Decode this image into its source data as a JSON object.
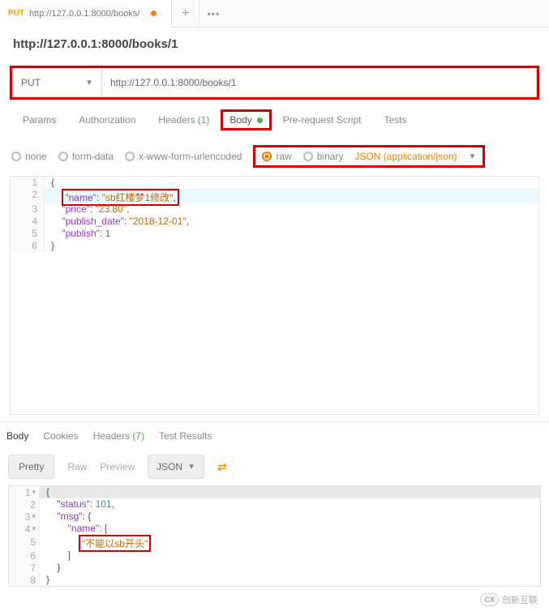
{
  "topTab": {
    "method": "PUT",
    "url": "http://127.0.0.1:8000/books/"
  },
  "title": "http://127.0.0.1:8000/books/1",
  "req": {
    "method": "PUT",
    "url": "http://127.0.0.1:8000/books/1"
  },
  "tabs": {
    "params": "Params",
    "auth": "Authorization",
    "headers": "Headers",
    "hcount": "(1)",
    "body": "Body",
    "prereq": "Pre-request Script",
    "tests": "Tests"
  },
  "bodyTypes": {
    "none": "none",
    "formdata": "form-data",
    "xform": "x-www-form-urlencoded",
    "raw": "raw",
    "binary": "binary",
    "ct": "JSON (application/json)"
  },
  "reqBody": {
    "l1": "{",
    "k2": "\"name\"",
    "v2": "\"sb红楼梦1修改\"",
    "k3": "\"price\"",
    "v3": "\"23.80\"",
    "k4": "\"publish_date\"",
    "v4": "\"2018-12-01\"",
    "k5": "\"publish\"",
    "v5": "1",
    "l6": "}"
  },
  "respTabs": {
    "body": "Body",
    "cookies": "Cookies",
    "headers": "Headers",
    "hcount": "(7)",
    "results": "Test Results"
  },
  "viewRow": {
    "pretty": "Pretty",
    "raw": "Raw",
    "preview": "Preview",
    "json": "JSON"
  },
  "respBody": {
    "l1": "{",
    "k2": "\"status\"",
    "v2": "101",
    "k3": "\"msg\"",
    "k4": "\"name\"",
    "v5": "\"不能以sb开头\"",
    "l6": "]",
    "l7": "}",
    "l8": "}"
  },
  "brand": "创新互联"
}
